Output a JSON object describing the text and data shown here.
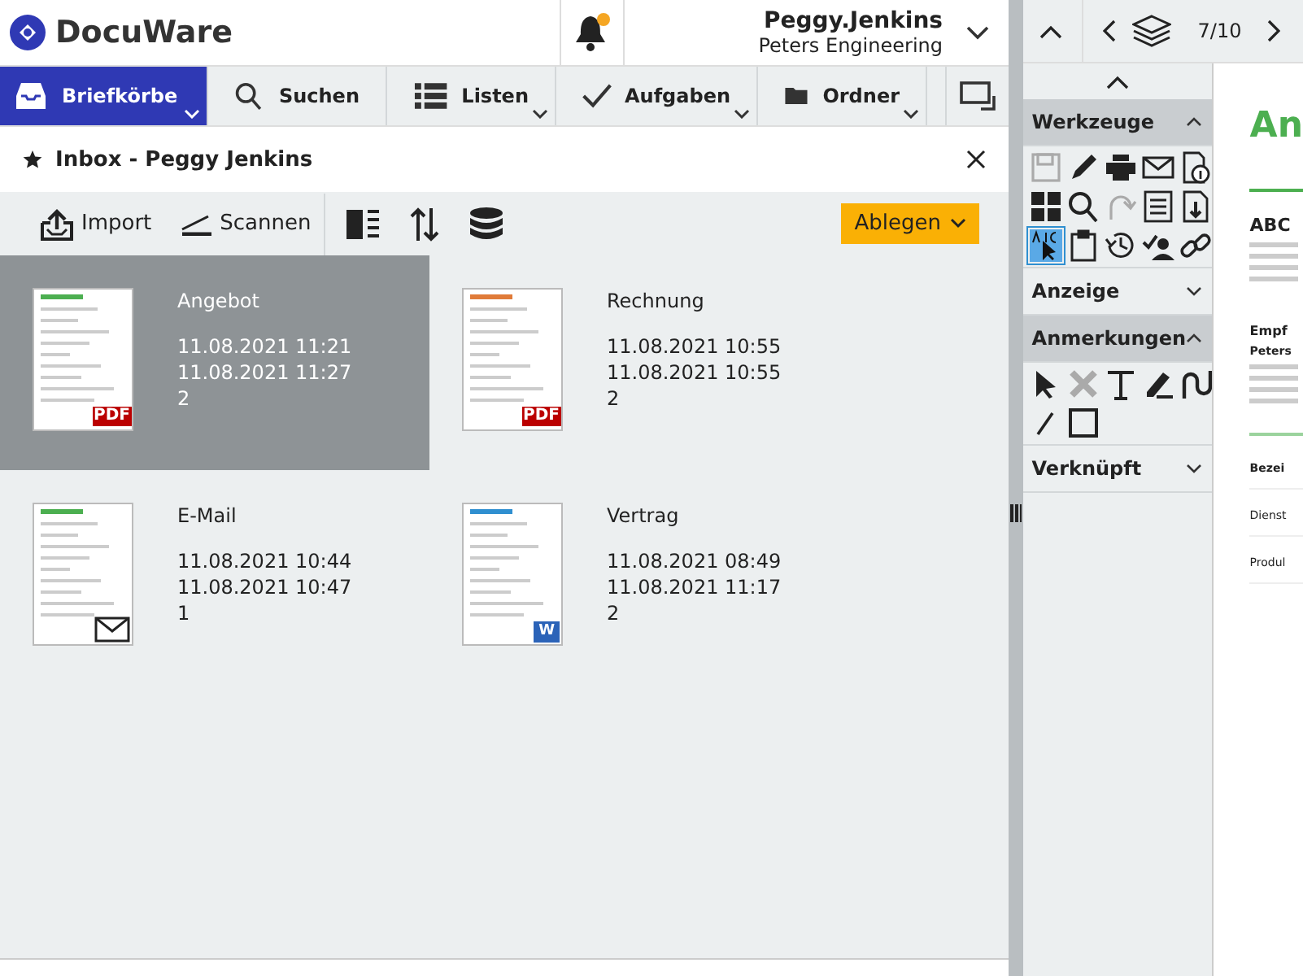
{
  "header": {
    "logo": "DocuWare",
    "notification_badge": true,
    "user": {
      "name": "Peggy.Jenkins",
      "company": "Peters Engineering"
    }
  },
  "nav": [
    {
      "label": "Briefkörbe",
      "selected": true,
      "has_menu": true
    },
    {
      "label": "Suchen",
      "selected": false,
      "has_menu": false
    },
    {
      "label": "Listen",
      "selected": false,
      "has_menu": true
    },
    {
      "label": "Aufgaben",
      "selected": false,
      "has_menu": true
    },
    {
      "label": "Ordner",
      "selected": false,
      "has_menu": true
    }
  ],
  "panel": {
    "title": "Inbox - Peggy Jenkins",
    "toolbar": [
      "Import",
      "Scannen"
    ],
    "file_button": "Ablegen",
    "documents": [
      {
        "title": "Angebot",
        "created": "11.08.2021 11:21",
        "modified": "11.08.2021 11:27",
        "count": "2",
        "kind": "pdf",
        "badge": "PDF",
        "color": "#4caf50",
        "selected": true
      },
      {
        "title": "Rechnung",
        "created": "11.08.2021 10:55",
        "modified": "11.08.2021 10:55",
        "count": "2",
        "kind": "pdf",
        "badge": "PDF",
        "color": "#e07b39",
        "selected": false
      },
      {
        "title": "E-Mail",
        "created": "11.08.2021 10:44",
        "modified": "11.08.2021 10:47",
        "count": "1",
        "kind": "mail",
        "color": "#4caf50",
        "selected": false
      },
      {
        "title": "Vertrag",
        "created": "11.08.2021 08:49",
        "modified": "11.08.2021 11:17",
        "count": "2",
        "kind": "word",
        "badge": "W",
        "color": "#2f8fd0",
        "selected": false
      }
    ]
  },
  "viewer": {
    "page_counter": "7/10",
    "sections": [
      {
        "title": "Werkzeuge",
        "expanded": true,
        "tools": [
          {
            "kind": "save",
            "disabled": true,
            "selected": false
          },
          {
            "kind": "pen",
            "disabled": false,
            "selected": false
          },
          {
            "kind": "print",
            "disabled": false,
            "selected": false
          },
          {
            "kind": "mail",
            "disabled": false,
            "selected": false
          },
          {
            "kind": "info",
            "disabled": false,
            "selected": false
          },
          {
            "kind": "grid",
            "disabled": false,
            "selected": false
          },
          {
            "kind": "search",
            "disabled": false,
            "selected": false
          },
          {
            "kind": "redo",
            "disabled": true,
            "selected": false
          },
          {
            "kind": "form",
            "disabled": false,
            "selected": false
          },
          {
            "kind": "download",
            "disabled": false,
            "selected": false
          },
          {
            "kind": "textselect",
            "disabled": false,
            "selected": true
          },
          {
            "kind": "clipboard",
            "disabled": false,
            "selected": false
          },
          {
            "kind": "history",
            "disabled": false,
            "selected": false
          },
          {
            "kind": "approve",
            "disabled": false,
            "selected": false
          },
          {
            "kind": "link",
            "disabled": false,
            "selected": false
          }
        ]
      },
      {
        "title": "Anzeige",
        "expanded": false
      },
      {
        "title": "Anmerkungen",
        "expanded": true,
        "tools": [
          {
            "kind": "pointer",
            "disabled": false,
            "selected": false
          },
          {
            "kind": "cross",
            "disabled": true,
            "selected": false
          },
          {
            "kind": "text",
            "disabled": false,
            "selected": false
          },
          {
            "kind": "highlighter",
            "disabled": false,
            "selected": false
          },
          {
            "kind": "curve",
            "disabled": false,
            "selected": false
          },
          {
            "kind": "line",
            "disabled": false,
            "selected": false
          },
          {
            "kind": "rect",
            "disabled": false,
            "selected": false
          }
        ]
      },
      {
        "title": "Verknüpft",
        "expanded": false
      }
    ],
    "document": {
      "heading": "An",
      "sender": "ABC",
      "recipient_label": "Empf",
      "recipient": "Peters",
      "table_rows": [
        "Bezei",
        "Dienst",
        "Produl"
      ]
    }
  }
}
